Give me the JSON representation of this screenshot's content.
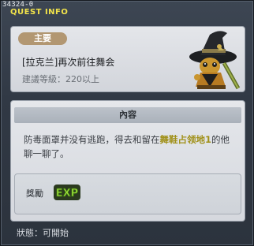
{
  "window": {
    "id": "34324-0",
    "title": "QUEST INFO"
  },
  "summary": {
    "category": "主要",
    "quest_name": "[拉克兰]再次前往舞会",
    "level_requirement": "建議等級：220以上",
    "npc_icon": "wizard-hat-npc-icon"
  },
  "content": {
    "header": "內容",
    "text_before": "防毒面罩并没有逃跑，得去和留在",
    "text_highlight": "舞鞋占领地1",
    "text_after": "的他聊一聊了。"
  },
  "reward": {
    "label": "獎勵",
    "type": "EXP",
    "icon": "exp-icon"
  },
  "status": {
    "text": "狀態：可開始"
  },
  "colors": {
    "title": "#f3e44a",
    "badge": "#b29772",
    "highlight": "#a09018",
    "exp_fill": "#9de23a"
  }
}
